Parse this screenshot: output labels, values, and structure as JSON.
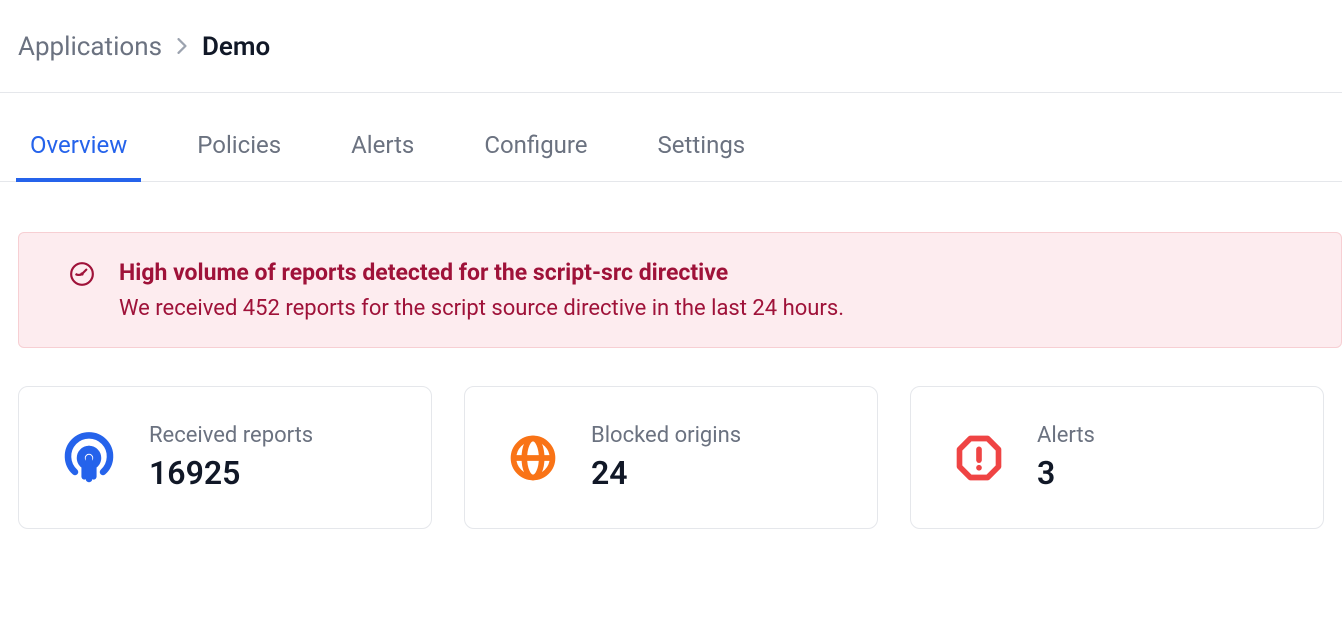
{
  "breadcrumb": {
    "parent": "Applications",
    "current": "Demo"
  },
  "tabs": [
    {
      "label": "Overview",
      "active": true
    },
    {
      "label": "Policies",
      "active": false
    },
    {
      "label": "Alerts",
      "active": false
    },
    {
      "label": "Configure",
      "active": false
    },
    {
      "label": "Settings",
      "active": false
    }
  ],
  "alert": {
    "title": "High volume of reports detected for the script-src directive",
    "description": "We received 452 reports for the script source directive in the last 24 hours."
  },
  "stats": {
    "received_reports": {
      "label": "Received reports",
      "value": "16925"
    },
    "blocked_origins": {
      "label": "Blocked origins",
      "value": "24"
    },
    "alerts": {
      "label": "Alerts",
      "value": "3"
    }
  }
}
